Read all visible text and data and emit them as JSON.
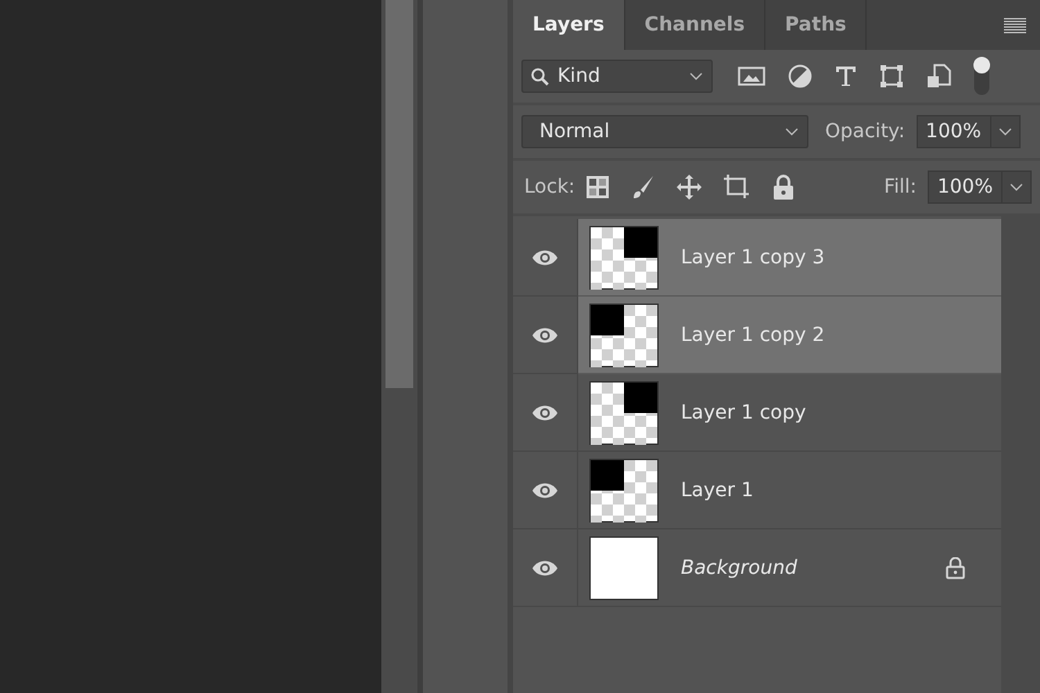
{
  "tabs": [
    {
      "label": "Layers",
      "selected": true
    },
    {
      "label": "Channels",
      "selected": false
    },
    {
      "label": "Paths",
      "selected": false
    }
  ],
  "filter": {
    "value": "Kind"
  },
  "blend_mode": {
    "value": "Normal"
  },
  "opacity": {
    "label": "Opacity:",
    "value": "100%"
  },
  "lock": {
    "label": "Lock:"
  },
  "fill": {
    "label": "Fill:",
    "value": "100%"
  },
  "layers": [
    {
      "name": "Layer 1 copy 3",
      "kind": "corner-right",
      "selected": true,
      "visible": true,
      "locked": false,
      "italic": false
    },
    {
      "name": "Layer 1 copy 2",
      "kind": "corner-left",
      "selected": true,
      "visible": true,
      "locked": false,
      "italic": false
    },
    {
      "name": "Layer 1 copy",
      "kind": "corner-right",
      "selected": false,
      "visible": true,
      "locked": false,
      "italic": false
    },
    {
      "name": "Layer 1",
      "kind": "corner-left",
      "selected": false,
      "visible": true,
      "locked": false,
      "italic": false
    },
    {
      "name": "Background",
      "kind": "white",
      "selected": false,
      "visible": true,
      "locked": true,
      "italic": true
    }
  ]
}
